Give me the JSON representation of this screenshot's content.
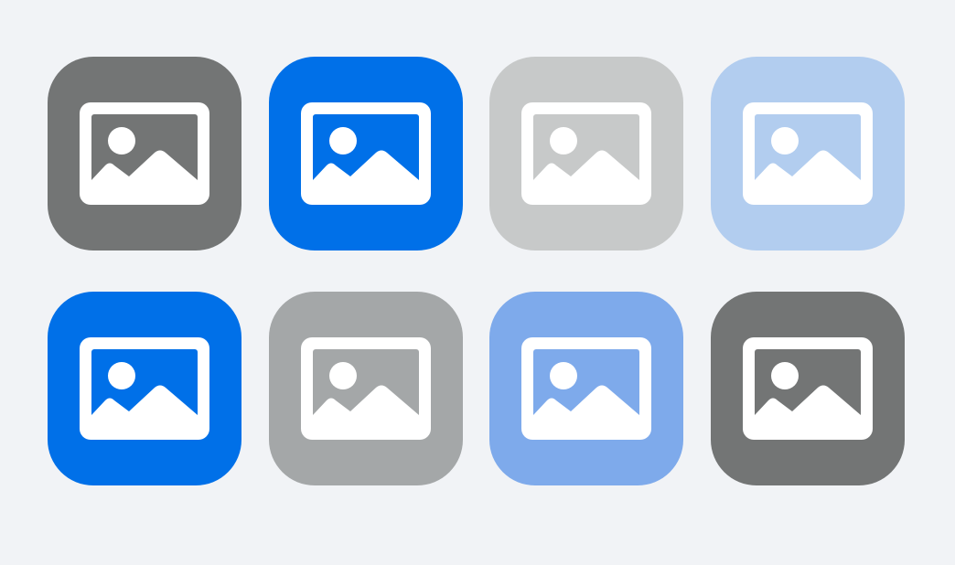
{
  "tiles": [
    {
      "icon": "image-icon",
      "color": "#737575"
    },
    {
      "icon": "image-icon",
      "color": "#0070e8"
    },
    {
      "icon": "image-icon",
      "color": "#c7c9c9"
    },
    {
      "icon": "image-icon",
      "color": "#b2cdef"
    },
    {
      "icon": "image-icon",
      "color": "#0070e8"
    },
    {
      "icon": "image-icon",
      "color": "#a4a7a8"
    },
    {
      "icon": "image-icon",
      "color": "#7eaaeb"
    },
    {
      "icon": "image-icon",
      "color": "#737575"
    }
  ],
  "glyph_color": "#ffffff"
}
